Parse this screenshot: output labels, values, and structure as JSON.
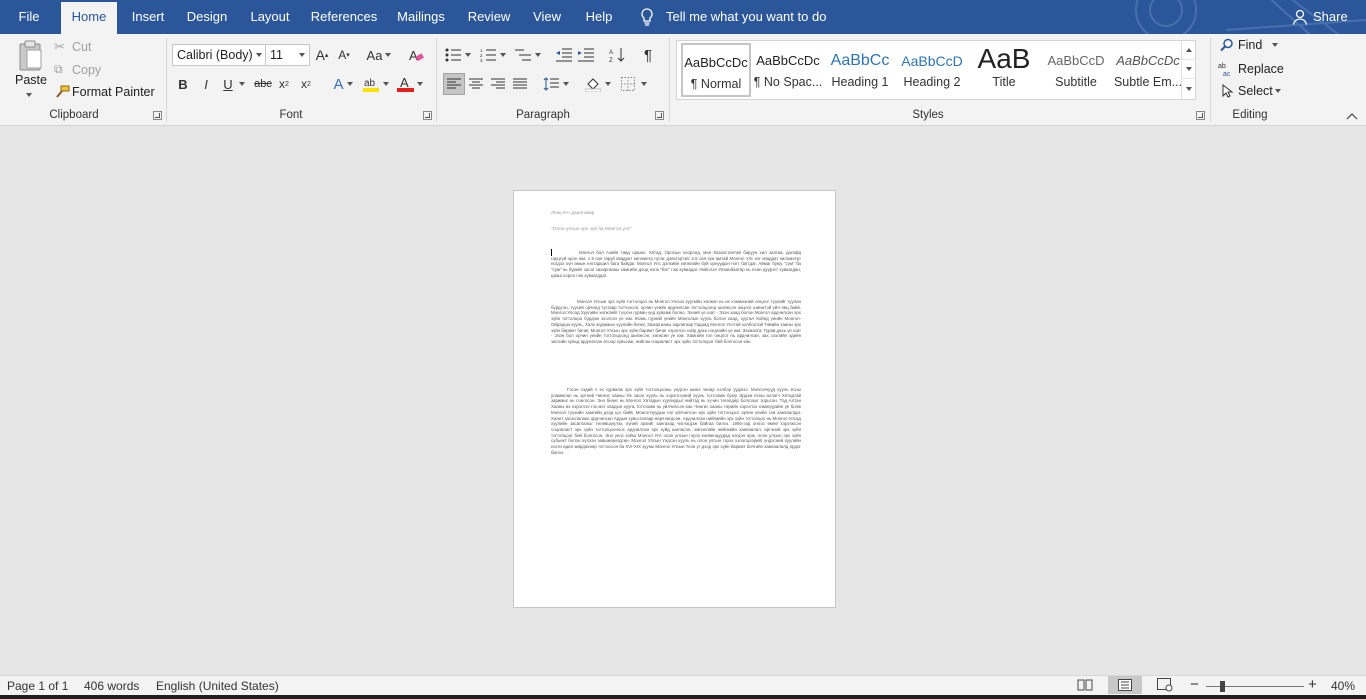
{
  "tabs": [
    "File",
    "Home",
    "Insert",
    "Design",
    "Layout",
    "References",
    "Mailings",
    "Review",
    "View",
    "Help"
  ],
  "tell_me": "Tell me what you want to do",
  "share": "Share",
  "clipboard": {
    "paste": "Paste",
    "cut": "Cut",
    "copy": "Copy",
    "format_painter": "Format Painter",
    "label": "Clipboard"
  },
  "font": {
    "name": "Calibri (Body)",
    "size": "11",
    "label": "Font"
  },
  "paragraph": {
    "label": "Paragraph"
  },
  "styles": {
    "label": "Styles",
    "items": [
      {
        "preview": "AaBbCcDc",
        "name": "¶ Normal"
      },
      {
        "preview": "AaBbCcDc",
        "name": "¶ No Spac..."
      },
      {
        "preview": "AaBbCc",
        "name": "Heading 1"
      },
      {
        "preview": "AaBbCcD",
        "name": "Heading 2"
      },
      {
        "preview": "AaB",
        "name": "Title"
      },
      {
        "preview": "AaBbCcD",
        "name": "Subtitle"
      },
      {
        "preview": "AaBbCcDc",
        "name": "Subtle Em..."
      }
    ]
  },
  "editing": {
    "find": "Find",
    "replace": "Replace",
    "select": "Select",
    "label": "Editing"
  },
  "document": {
    "title_line": "Лекц 9-н даалгавар",
    "subtitle_line": "\"Олон улсын эрх зүй ба Монгол улс\"",
    "para1": "Монгол бол Азийн төвд орших, Хятад, Оросын хооронд, мөн Казахстантай баруун хил залгаа, далайд гарцгүй орон юм. 1.5 сая гаруй квадрат километр нутаг дэвсгэртэй, 2.6 сая хүн амтай Монгол Улс нэг квадрат километрт ногдох хүн амын нягтаршил бага байдаг. Монгол Улс дэлхийн хөгжлийн буй орнуудын нэгт багтдаг. Аймаг буюу \"сум\" ба \"сум\" нь бүрийг засаг захиргааны хамгийн доод нэгж \"баг\" гэж хуваадаг. Нийслэл Улаанбаатар нь есөн дүүрэгт хуваагдан, цааш хороо гэж хуваагддаг.",
    "para2": "Монгол Улсын эрх зүйн тогтолцоо нь Монгол Улсын хуулийн хөгжил нь их хэмжээний онцлог түүхийг туулан бүрдсэн, түүхий орчинд тусгаар тогтносон, орчин үеийн ардчилсан тогтолцоонд шилжсэн онцлог шинжтэй үйл явц байв. Монгол Улсад Хуулийн хөгжлийг түүхэн гурван үед хувааж болно. Эхний үе шат - Эзэн хаад болон Монгол ардчилсан эрх зүйн тогтолцоо бүрдэж эхэлсэн үе юм. Юань гүрний үеийн Монголын хууль болон хаад, хуульч Хойнд үеийн Монгол-Ойрадын хууль, Халх журамын хуулийн бичиг, Захиргааны зарлигаар Гадаад Монгол Улстай холбоотой Төвийн хааны эрх зүйн баримт бичиг, Монгол Улсын эрх зүйн баримт бичиг хэрэглээ хойр дахь нэгдлийн үе юм. Захиалга: Гурав дахь үе шат - Эзэн бол орчин үеийн тогтолцоонд шилжсэн, хөгжсөн үе юм. Хамгийн гол онцлог нь ардчилсан, зах зээлийн эдийн засгийн хувьд ардчилсан ёсоор хувьсаж, нийгэм социалист эрх зүйн тогтолцоог бий болгосон юм.",
    "para3": "Гэсэн хэдий ч эх сурвалж эрх зүйн тогтолцооны үндсэн шинэ чанар хэлбэр ууджээ. Монголчууд хууль ёсны уламжлал нь эртний Чингис хааны Их засаг хууль нь хэрэглээний хууль тогтоомж буюу Эрдэм ёсны ахлагч Хятадтай заримыг нь сонгосон. Энэ бичиг нь Монгол Хятадын хуулиудыг нийтэд нь хүчин төгөлдөр болгохыг зорьсон. Тэд Алтан Хааны их хэрэглээ гэх мэт хаадын хууль тогтоомж нь үйлчилсэн юм. Чингис хааны төрийн хэрэглээ хэмжүүрийн үе болж Монгол түүхийн хамгийн дээд цэг байв. Монголчуудын гол үйлчилсэн эрх зүйн тогтолцоог орчин үеийн гэж хамгаалдаг. Хаант засаглалаас ардчилсан Ардын хувьсгалаар өөрчлөгдсөн. Ардчилсан нийгмийн эрх зүйн тогтолцоо нь Монгол Улсад хуулийн засаглалыг төлөвшүүлэх, хүний эрхийг хангахад чиглэгдэж байгаа билээ. 1990-ээд оноос өмнө хэрэгжсэн социалист эрх зүйн тогтолцооноос ардчилсан эрх зүйд шилжсэн, эмнэлгийн нийгмийн хамгаалал, иргэний эрх зүйн тогтолцоог бий болгосон. Энэ үеэс хойш Монгол Улс олон улсын гэрээ конвенцуудад нэгдэн орж, олон улсын эрх зүйн субьект болон хүлээн зөвшөөрөгдсөн. Монгол Улсын Үндсэн хууль нь олон улсын гэрээ хэлэлцээрийг үндэсний хуулийн нэгэн адил мөрдөхөөр тогтоосон ба XVI-XIX зууны Монгол Улсын Үнэн үг дээд эрх зүйн баримт бичгийн хамгаалалд ордог билээ."
  },
  "status": {
    "page": "Page 1 of 1",
    "words": "406 words",
    "language": "English (United States)",
    "zoom": "40%"
  }
}
